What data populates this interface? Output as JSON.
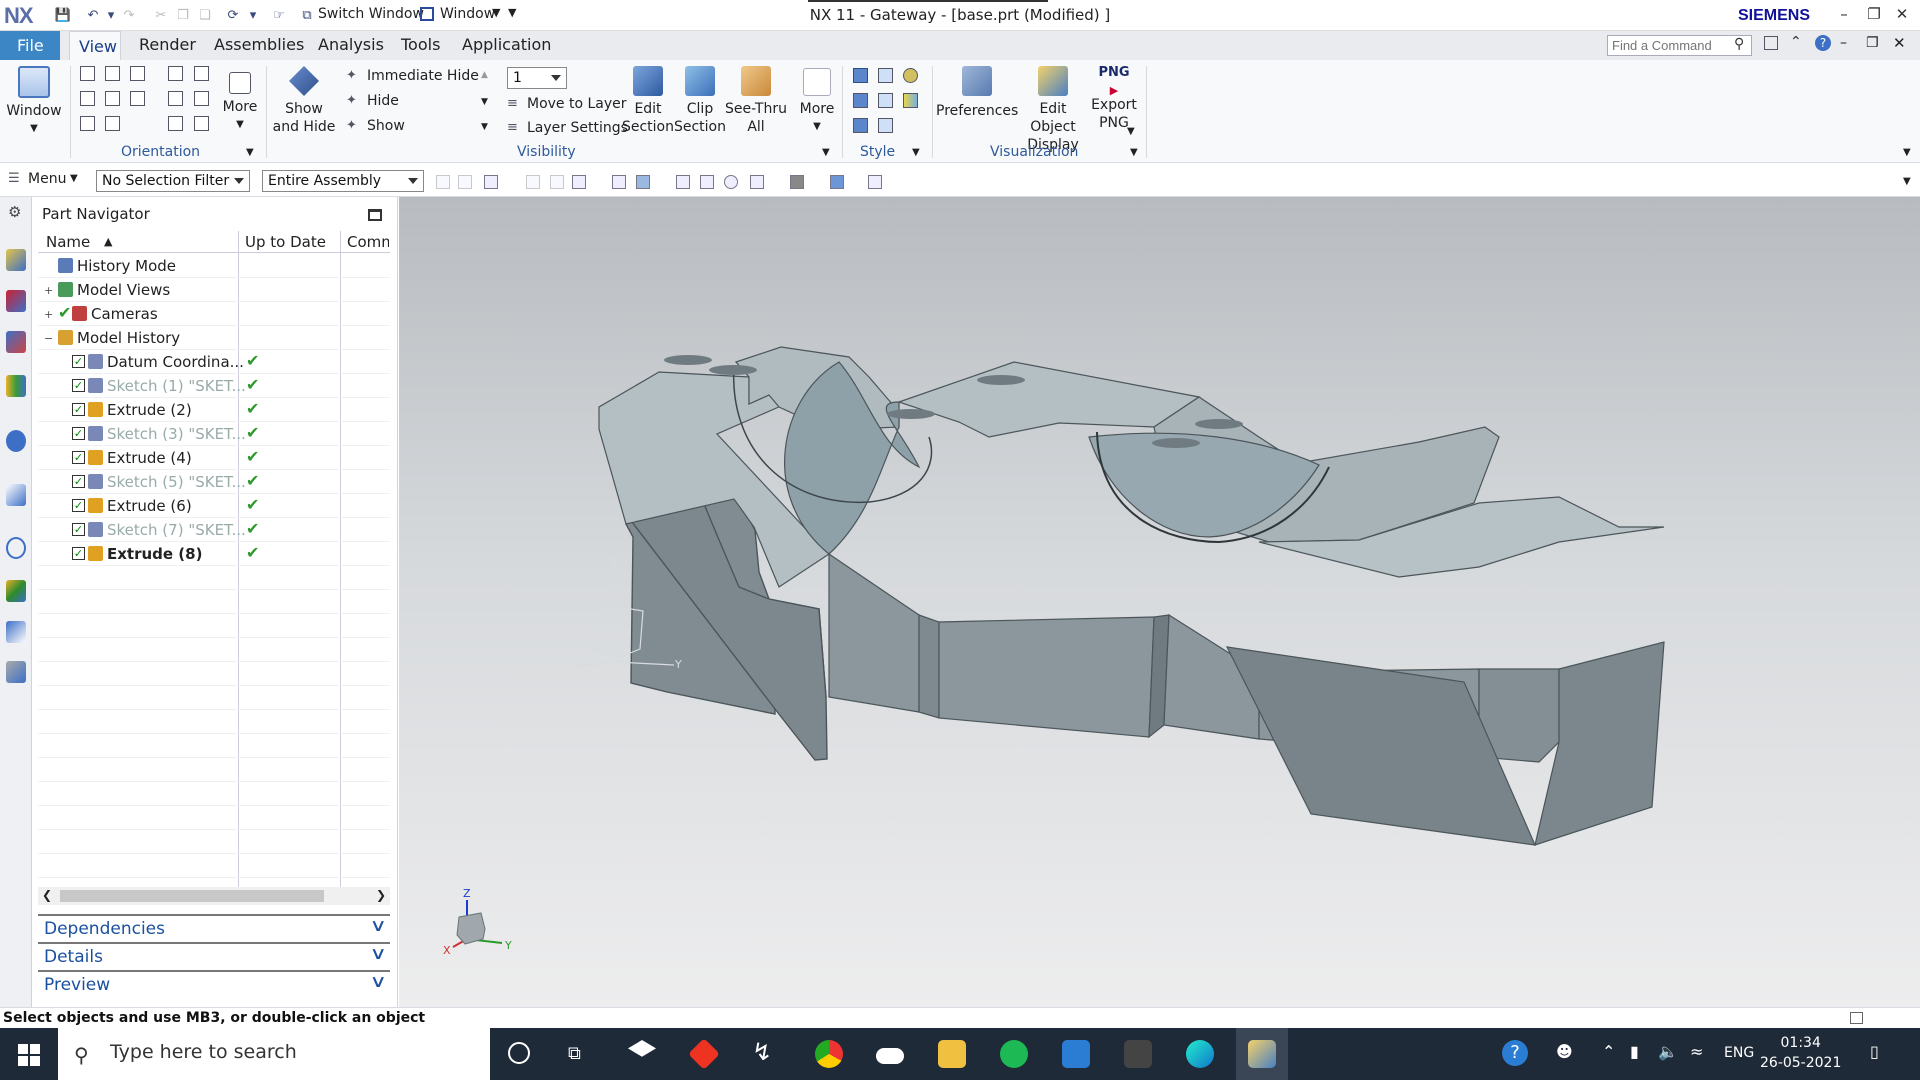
{
  "titlebar": {
    "logo": "NX",
    "switch_window": "Switch Window",
    "window_menu": "Window",
    "title": "NX 11 - Gateway - [base.prt (Modified) ]",
    "brand": "SIEMENS"
  },
  "menubar": {
    "file": "File",
    "tabs": [
      "View",
      "Render",
      "Assemblies",
      "Analysis",
      "Tools",
      "Application"
    ],
    "find_placeholder": "Find a Command"
  },
  "ribbon": {
    "window": {
      "label": "Window"
    },
    "orientation": {
      "more": "More",
      "group": "Orientation"
    },
    "show_hide": {
      "line1": "Show",
      "line2": "and Hide"
    },
    "visibility": {
      "immediate_hide": "Immediate Hide",
      "hide": "Hide",
      "show": "Show",
      "layer_value": "1",
      "move_to_layer": "Move to Layer",
      "layer_settings": "Layer Settings",
      "group": "Visibility"
    },
    "edit_section": {
      "line1": "Edit",
      "line2": "Section"
    },
    "clip_section": {
      "line1": "Clip",
      "line2": "Section"
    },
    "see_thru": {
      "line1": "See-Thru",
      "line2": "All"
    },
    "more2": "More",
    "style": {
      "group": "Style"
    },
    "visualization": {
      "preferences": "Preferences",
      "edit_obj_1": "Edit Object",
      "edit_obj_2": "Display",
      "export_1": "Export",
      "export_2": "PNG",
      "png": "PNG",
      "group": "Visualization"
    }
  },
  "toolbar2": {
    "menu": "Menu",
    "selection_filter": "No Selection Filter",
    "scope": "Entire Assembly"
  },
  "navigator": {
    "title": "Part Navigator",
    "columns": [
      "Name",
      "Up to Date",
      "Comm"
    ],
    "rows": [
      {
        "name": "History Mode",
        "style": "normal"
      },
      {
        "name": "Model Views",
        "style": "normal"
      },
      {
        "name": "Cameras",
        "style": "normal"
      },
      {
        "name": "Model History",
        "style": "normal"
      },
      {
        "name": "Datum Coordina...",
        "style": "normal"
      },
      {
        "name": "Sketch (1) \"SKET...",
        "style": "dim"
      },
      {
        "name": "Extrude (2)",
        "style": "normal"
      },
      {
        "name": "Sketch (3) \"SKET...",
        "style": "dim"
      },
      {
        "name": "Extrude (4)",
        "style": "normal"
      },
      {
        "name": "Sketch (5) \"SKET...",
        "style": "dim"
      },
      {
        "name": "Extrude (6)",
        "style": "normal"
      },
      {
        "name": "Sketch (7) \"SKET...",
        "style": "dim"
      },
      {
        "name": "Extrude (8)",
        "style": "bold"
      }
    ],
    "panels": [
      "Dependencies",
      "Details",
      "Preview"
    ]
  },
  "viewport": {
    "axis_x": "X",
    "axis_y": "Y",
    "axis_z": "Z"
  },
  "status": "Select objects and use MB3, or double-click an object",
  "taskbar": {
    "search_placeholder": "Type here to search",
    "lang": "ENG",
    "time": "01:34",
    "date": "26-05-2021"
  },
  "colors": {
    "accent": "#3d86c6",
    "part_face": "#8e9aa0",
    "taskbar": "#1f2a38"
  }
}
